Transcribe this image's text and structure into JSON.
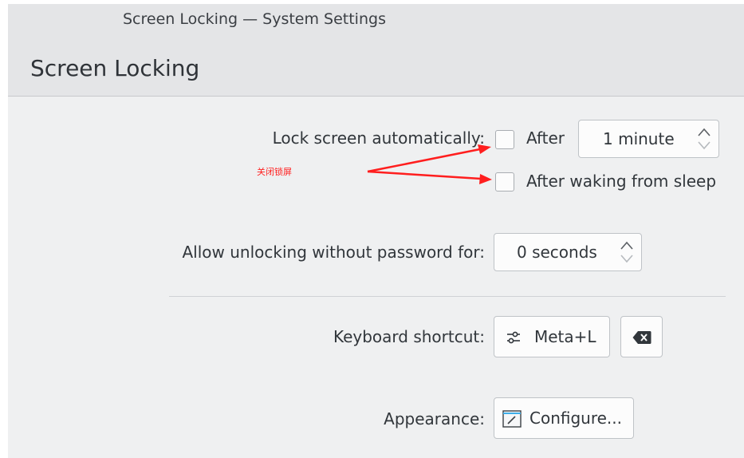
{
  "window": {
    "title": "Screen Locking — System Settings"
  },
  "page": {
    "title": "Screen Locking"
  },
  "lock_automatically": {
    "label": "Lock screen automatically:",
    "after_label": "After",
    "after_checked": false,
    "after_value": "1 minute",
    "after_waking_label": "After waking from sleep",
    "after_waking_checked": false
  },
  "unlock_without_password": {
    "label": "Allow unlocking without password for:",
    "value": "0 seconds"
  },
  "keyboard_shortcut": {
    "label": "Keyboard shortcut:",
    "value": "Meta+L",
    "icon": "configure-shortcut-icon",
    "clear_icon": "clear-backspace-icon"
  },
  "appearance": {
    "label": "Appearance:",
    "button_label": "Configure...",
    "icon": "configure-icon"
  },
  "annotation": {
    "text": "关闭锁屏",
    "color": "#ff1e1e"
  }
}
